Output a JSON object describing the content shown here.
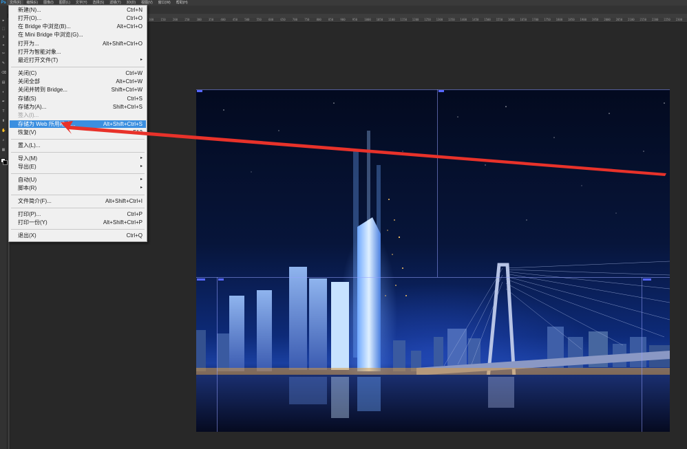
{
  "app": {
    "logo": "Ps",
    "menubar": [
      "文件(F)",
      "编辑(E)",
      "图像(I)",
      "图层(L)",
      "文字(Y)",
      "选择(S)",
      "滤镜(T)",
      "3D(D)",
      "视图(V)",
      "窗口(W)",
      "帮助(H)"
    ]
  },
  "ruler": {
    "labels": [
      "100",
      "150",
      "200",
      "250",
      "300",
      "350",
      "400",
      "450",
      "500",
      "550",
      "600",
      "650",
      "700",
      "750",
      "800",
      "850",
      "900",
      "950",
      "1000",
      "1050",
      "1100",
      "1150",
      "1200",
      "1250",
      "1300",
      "1350",
      "1400",
      "1450",
      "1500",
      "1550",
      "1600",
      "1650",
      "1700",
      "1750",
      "1800",
      "1850",
      "1900",
      "1950",
      "2000",
      "2050",
      "2100",
      "2150",
      "2200",
      "2250",
      "2300"
    ]
  },
  "tools": [
    "▸",
    "⬚",
    "ↄ",
    "⌖",
    "✂",
    "✎",
    "⌫",
    "▤",
    "◐",
    "✒",
    "T",
    "⬆",
    "✋",
    "⌕",
    "▦"
  ],
  "file_menu": {
    "items": [
      {
        "label": "新建(N)...",
        "shortcut": "Ctrl+N"
      },
      {
        "label": "打开(O)...",
        "shortcut": "Ctrl+O"
      },
      {
        "label": "在 Bridge 中浏览(B)...",
        "shortcut": "Alt+Ctrl+O"
      },
      {
        "label": "在 Mini Bridge 中浏览(G)...",
        "shortcut": ""
      },
      {
        "label": "打开为...",
        "shortcut": "Alt+Shift+Ctrl+O"
      },
      {
        "label": "打开为智能对象...",
        "shortcut": ""
      },
      {
        "label": "最近打开文件(T)",
        "shortcut": "",
        "submenu": "▸"
      },
      {
        "label": "关闭(C)",
        "shortcut": "Ctrl+W"
      },
      {
        "label": "关闭全部",
        "shortcut": "Alt+Ctrl+W"
      },
      {
        "label": "关闭并转到 Bridge...",
        "shortcut": "Shift+Ctrl+W"
      },
      {
        "label": "存储(S)",
        "shortcut": "Ctrl+S"
      },
      {
        "label": "存储为(A)...",
        "shortcut": "Shift+Ctrl+S"
      },
      {
        "label": "签入(I)...",
        "shortcut": ""
      },
      {
        "label": "存储为 Web 所用格式...",
        "shortcut": "Alt+Shift+Ctrl+S"
      },
      {
        "label": "恢复(V)",
        "shortcut": "F12"
      },
      {
        "label": "置入(L)...",
        "shortcut": ""
      },
      {
        "label": "导入(M)",
        "shortcut": "",
        "submenu": "▸"
      },
      {
        "label": "导出(E)",
        "shortcut": "",
        "submenu": "▸"
      },
      {
        "label": "自动(U)",
        "shortcut": "",
        "submenu": "▸"
      },
      {
        "label": "脚本(R)",
        "shortcut": "",
        "submenu": "▸"
      },
      {
        "label": "文件简介(F)...",
        "shortcut": "Alt+Shift+Ctrl+I"
      },
      {
        "label": "打印(P)...",
        "shortcut": "Ctrl+P"
      },
      {
        "label": "打印一份(Y)",
        "shortcut": "Alt+Shift+Ctrl+P"
      },
      {
        "label": "退出(X)",
        "shortcut": "Ctrl+Q"
      }
    ]
  },
  "colors": {
    "menu_highlight": "#3b8fe0",
    "annotation_arrow": "#e8322a",
    "slice_line": "#8c96ff"
  }
}
